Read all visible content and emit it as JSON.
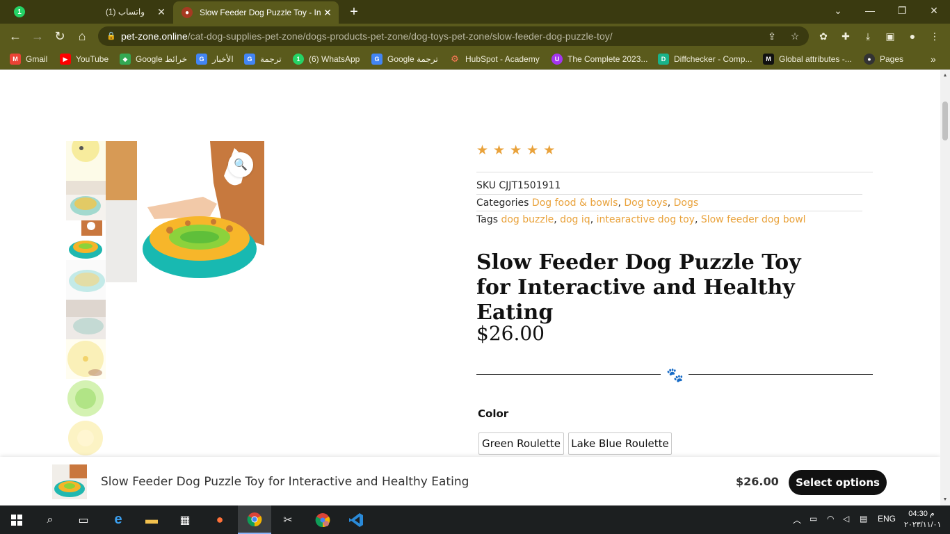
{
  "browser": {
    "tabs": [
      {
        "title": "(1) واتساب",
        "icon": "whatsapp-icon",
        "badge": "1"
      },
      {
        "title": "Slow Feeder Dog Puzzle Toy - In",
        "icon": "pet-zone-favicon"
      }
    ],
    "url_host": "pet-zone.online",
    "url_path": "/cat-dog-supplies-pet-zone/dogs-products-pet-zone/dog-toys-pet-zone/slow-feeder-dog-puzzle-toy/",
    "bookmarks": [
      {
        "label": "Gmail",
        "icon": "gmail-icon",
        "color": "#ea4335",
        "glyph": "M"
      },
      {
        "label": "YouTube",
        "icon": "youtube-icon",
        "color": "#ff0000",
        "glyph": "▶"
      },
      {
        "label": "Google خرائط",
        "icon": "maps-icon",
        "color": "#34a853",
        "glyph": "◆"
      },
      {
        "label": "الأخبار",
        "icon": "news-icon",
        "color": "#4285f4",
        "glyph": "G"
      },
      {
        "label": "ترجمة",
        "icon": "translate-icon",
        "color": "#4285f4",
        "glyph": "G"
      },
      {
        "label": "(6) WhatsApp",
        "icon": "whatsapp-icon",
        "color": "#25d366",
        "glyph": "1"
      },
      {
        "label": "Google ترجمة",
        "icon": "translate-icon",
        "color": "#4285f4",
        "glyph": "G"
      },
      {
        "label": "HubSpot - Academy",
        "icon": "hubspot-icon",
        "color": "#ff7a59",
        "glyph": "⚙"
      },
      {
        "label": "The Complete 2023...",
        "icon": "udemy-icon",
        "color": "#a435f0",
        "glyph": "U"
      },
      {
        "label": "Diffchecker - Comp...",
        "icon": "diffchecker-icon",
        "color": "#19b38a",
        "glyph": "D"
      },
      {
        "label": "Global attributes -...",
        "icon": "mdn-icon",
        "color": "#111111",
        "glyph": "M"
      },
      {
        "label": "Pages",
        "icon": "github-icon",
        "color": "#333333",
        "glyph": "●"
      }
    ]
  },
  "product": {
    "rating_stars": 5,
    "sku_label": "SKU",
    "sku": "CJJT1501911",
    "categories_label": "Categories",
    "categories": [
      "Dog food & bowls",
      "Dog toys",
      "Dogs"
    ],
    "tags_label": "Tags",
    "tags": [
      "dog buzzle",
      "dog iq",
      "intearactive dog toy",
      "Slow feeder dog bowl"
    ],
    "title": "Slow Feeder Dog Puzzle Toy for Interactive and Healthy Eating",
    "price": "$26.00",
    "color_label": "Color",
    "color_options": [
      "Green Roulette",
      "Lake Blue Roulette"
    ],
    "accent_color": "#e9a23b"
  },
  "sticky_bar": {
    "name": "Slow Feeder Dog Puzzle Toy for Interactive and Healthy Eating",
    "price": "$26.00",
    "button": "Select options"
  },
  "taskbar": {
    "lang": "ENG",
    "time": "04:30 م",
    "date": "٢٠٢٣/١١/٠١"
  }
}
